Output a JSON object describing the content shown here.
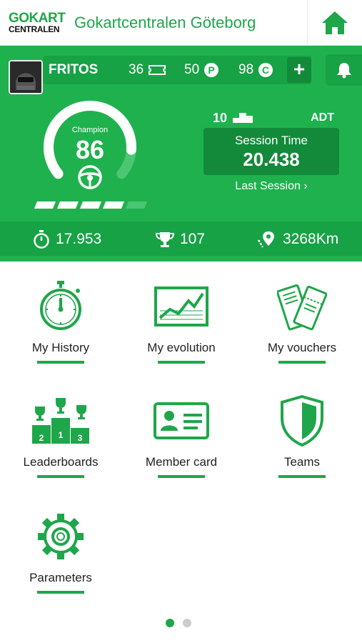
{
  "header": {
    "logo_line1": "GOKART",
    "logo_line2": "CENTRALEN",
    "title": "Gokartcentralen Göteborg",
    "home_icon": "home-icon"
  },
  "user": {
    "name": "FRITOS",
    "tickets": "36",
    "points": "50",
    "credits": "98",
    "add_icon": "plus-icon",
    "notifications_icon": "bell-icon"
  },
  "rank": {
    "label": "Champion",
    "value": "86",
    "gauge_fraction": 0.86,
    "level_segments_filled": 4,
    "level_segments_total": 5
  },
  "adt": {
    "value": "10",
    "label": "ADT"
  },
  "session": {
    "label": "Session Time",
    "value": "20.438",
    "last_session_link": "Last Session"
  },
  "stats": {
    "best_time": "17.953",
    "trophies": "107",
    "distance": "3268Km"
  },
  "menu": {
    "history": "My History",
    "evolution": "My evolution",
    "vouchers": "My vouchers",
    "leaderboards": "Leaderboards",
    "member_card": "Member card",
    "teams": "Teams",
    "parameters": "Parameters"
  },
  "pager": {
    "current_page": 1,
    "total_pages": 2
  },
  "colors": {
    "brand_green": "#1fb14e",
    "dark_green": "#128a3a",
    "icon_green": "#1fa64a"
  }
}
